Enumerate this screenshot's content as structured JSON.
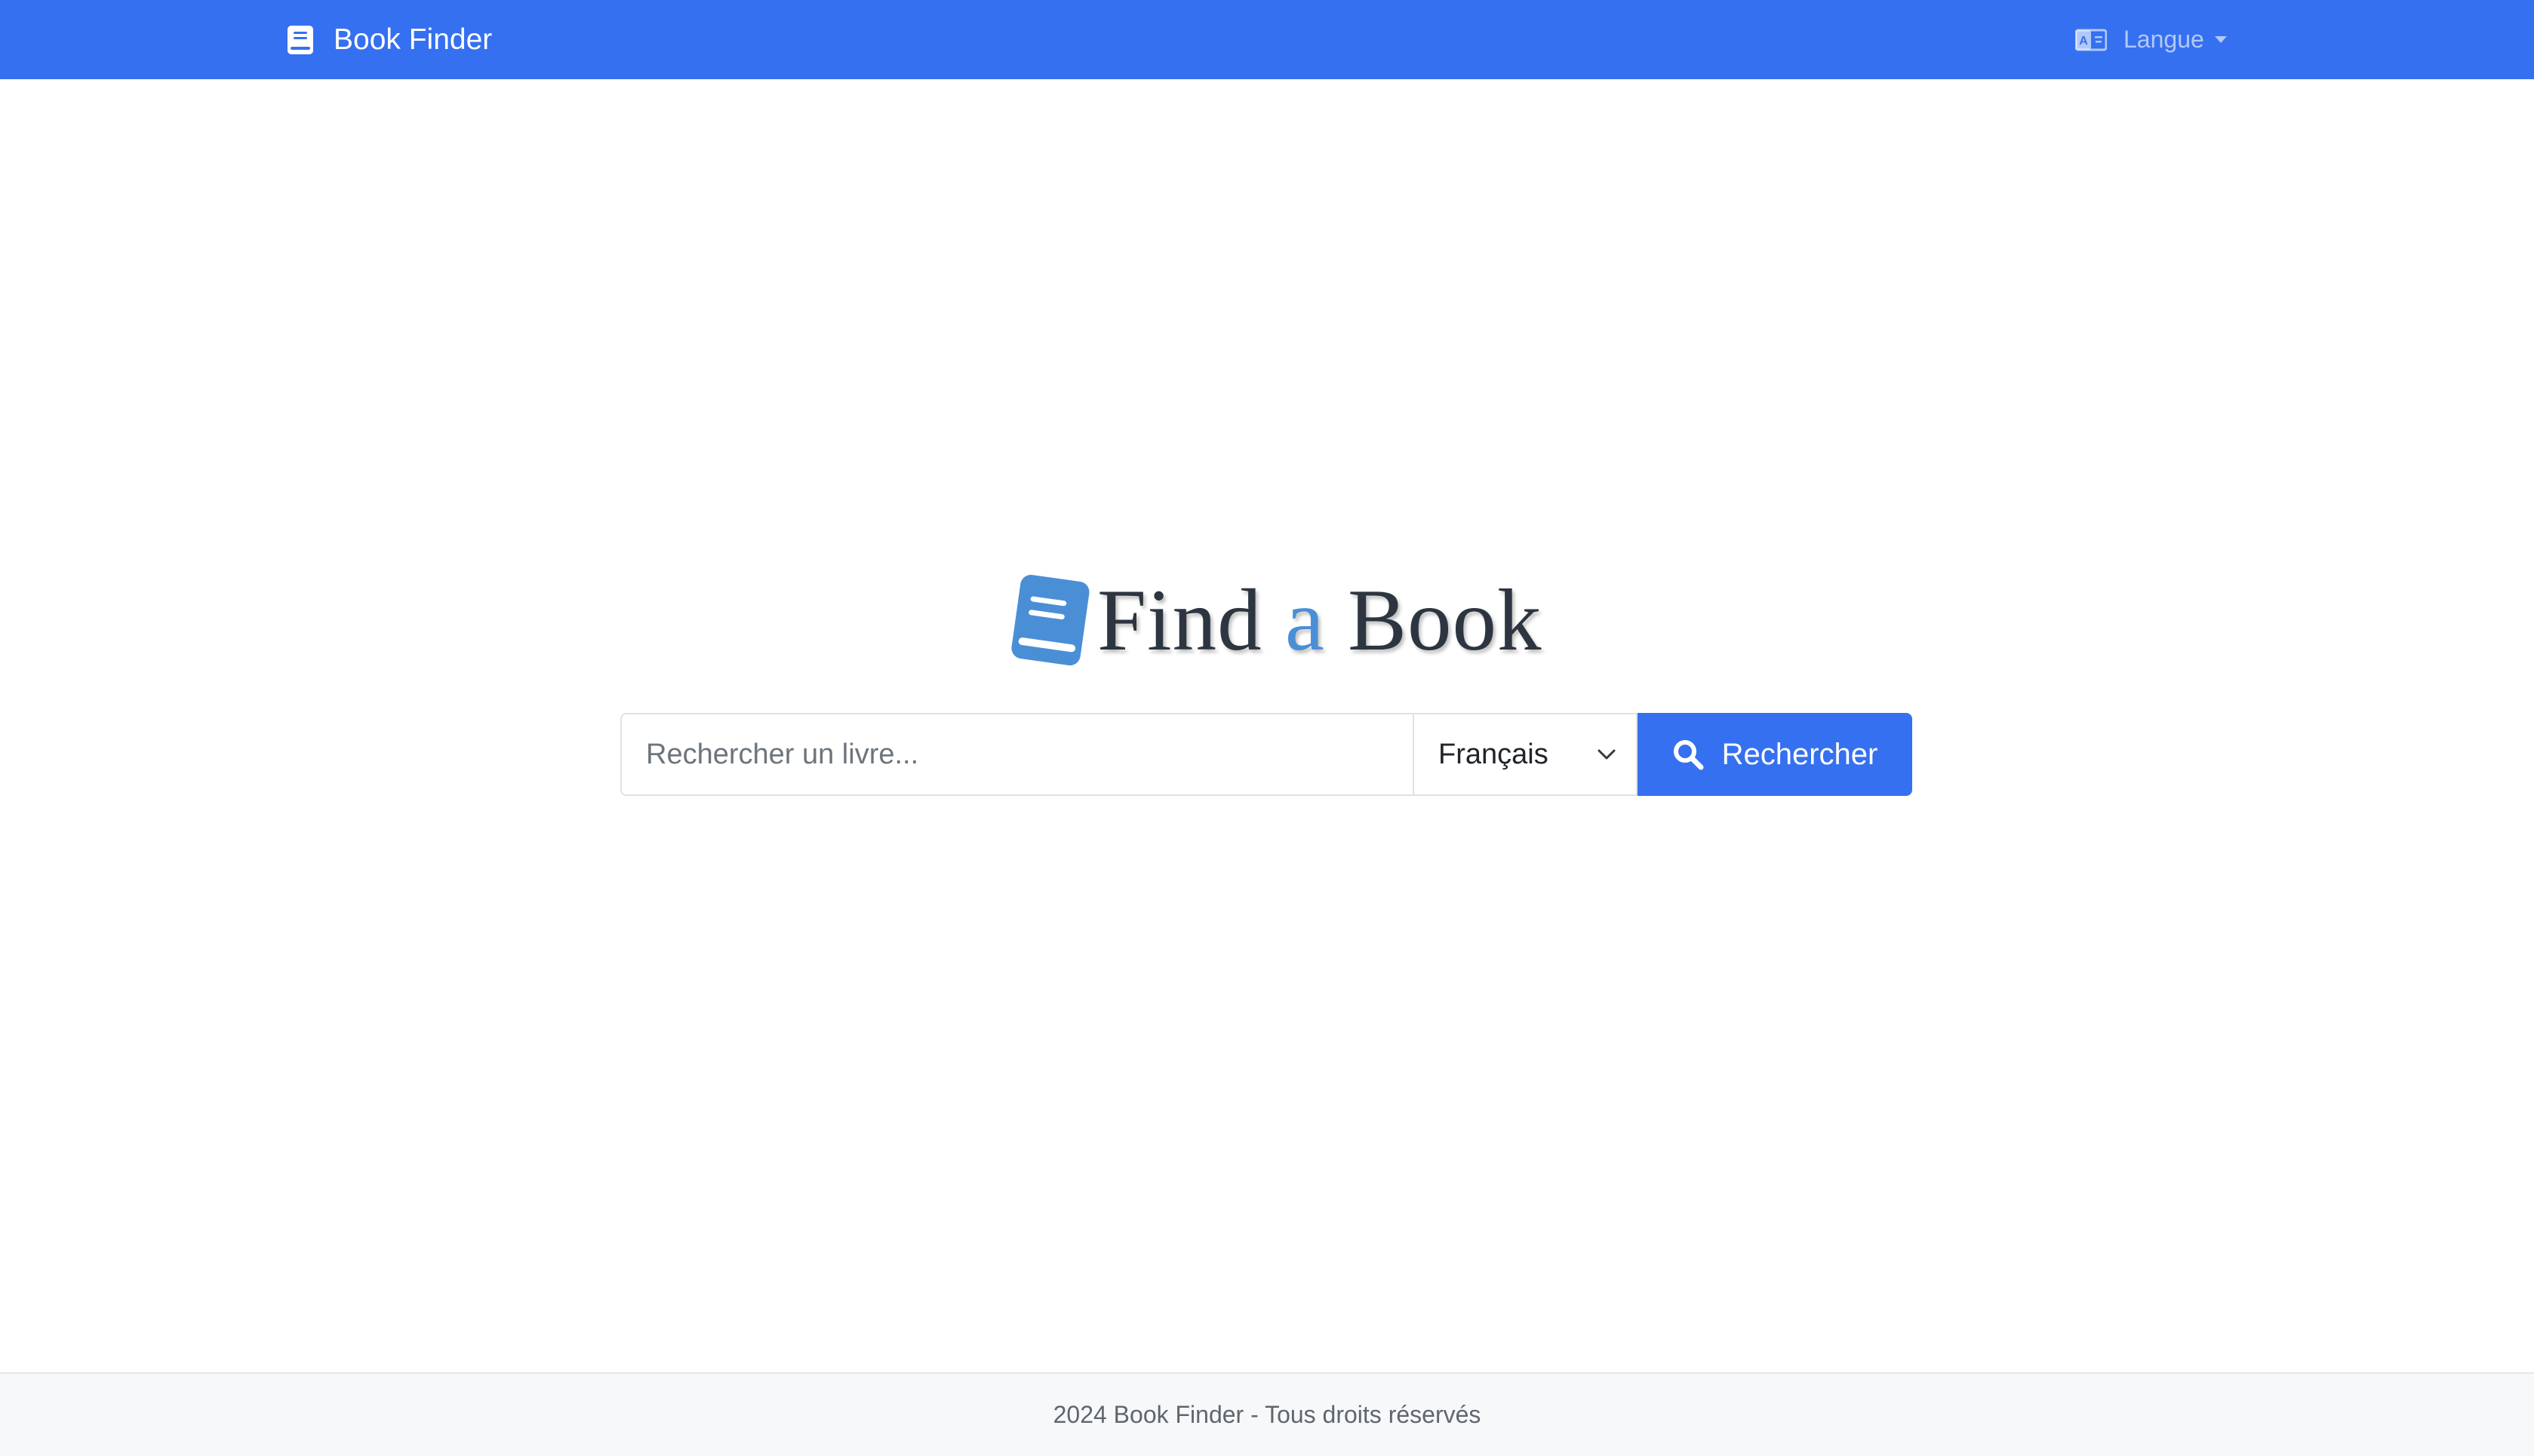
{
  "navbar": {
    "brand_label": "Book Finder",
    "brand_icon": "book-icon",
    "language_label": "Langue",
    "language_icon": "translate-icon"
  },
  "hero": {
    "title_part1": "Find",
    "title_accent": "a",
    "title_part2": "Book",
    "logo_icon": "book-icon"
  },
  "search": {
    "placeholder": "Rechercher un livre...",
    "value": "",
    "language_selected": "Français",
    "button_label": "Rechercher",
    "button_icon": "search-icon"
  },
  "footer": {
    "text": "2024 Book Finder - Tous droits réservés"
  },
  "colors": {
    "primary": "#3570f0",
    "accent": "#4a8fd6",
    "title": "#2d3540",
    "footer_bg": "#f7f8fa"
  }
}
